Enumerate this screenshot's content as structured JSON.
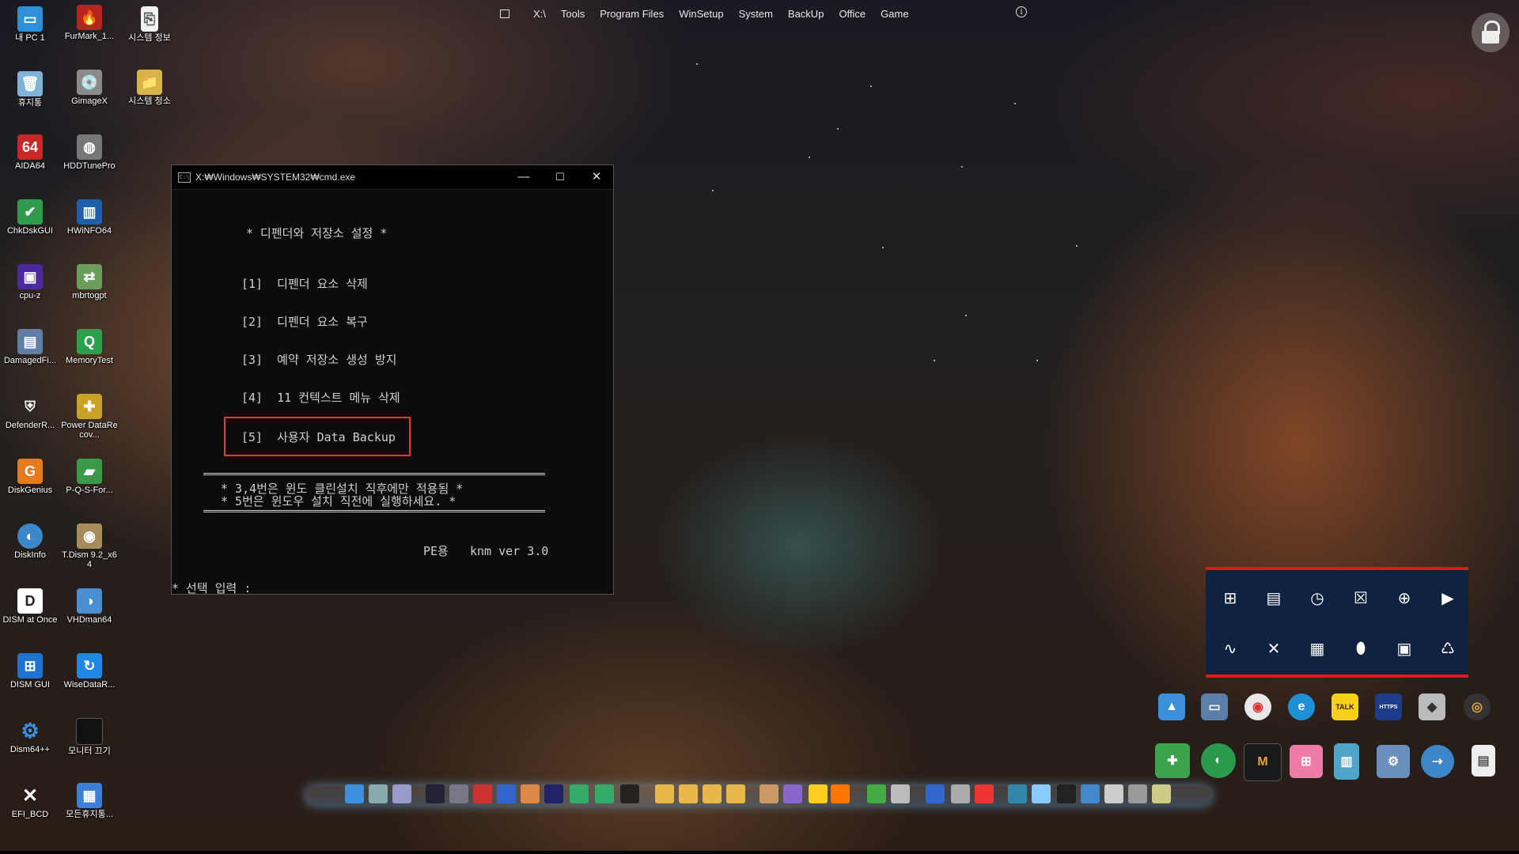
{
  "topmenu": {
    "items": [
      "X:\\",
      "Tools",
      "Program Files",
      "WinSetup",
      "System",
      "BackUp",
      "Office",
      "Game"
    ]
  },
  "desktop_icons": [
    {
      "label": "내 PC 1",
      "icon": "monitor-icon"
    },
    {
      "label": "FurMark_1...",
      "icon": "furmark-icon"
    },
    {
      "label": "시스템 정보",
      "icon": "document-icon"
    },
    {
      "label": "휴지통",
      "icon": "recycle-bin-icon"
    },
    {
      "label": "GimageX",
      "icon": "gimagex-icon"
    },
    {
      "label": "시스템 청소",
      "icon": "folder-icon"
    },
    {
      "label": "AIDA64",
      "icon": "aida64-icon"
    },
    {
      "label": "HDDTunePro",
      "icon": "disk-icon"
    },
    {
      "label": "ChkDskGUI",
      "icon": "chkdsk-icon"
    },
    {
      "label": "HWiNFO64",
      "icon": "hwinfo-icon"
    },
    {
      "label": "cpu-z",
      "icon": "cpuz-icon"
    },
    {
      "label": "mbrtogpt",
      "icon": "mbrtogpt-icon"
    },
    {
      "label": "DamagedFi...",
      "icon": "damaged-files-icon"
    },
    {
      "label": "MemoryTest",
      "icon": "memtest-icon"
    },
    {
      "label": "DefenderR...",
      "icon": "shield-icon"
    },
    {
      "label": "Power DataRecov...",
      "icon": "recovery-icon"
    },
    {
      "label": "DiskGenius",
      "icon": "diskgenius-icon"
    },
    {
      "label": "P-Q-S-For...",
      "icon": "pqs-icon"
    },
    {
      "label": "DiskInfo",
      "icon": "diskinfo-icon"
    },
    {
      "label": "T.Dism 9.2_x64",
      "icon": "tdism-icon"
    },
    {
      "label": "DISM at Once",
      "icon": "dism-once-icon"
    },
    {
      "label": "VHDman64",
      "icon": "vhdman-icon"
    },
    {
      "label": "DISM GUI",
      "icon": "windows-icon"
    },
    {
      "label": "WiseDataR...",
      "icon": "wise-icon"
    },
    {
      "label": "Dism64++",
      "icon": "gear-icon"
    },
    {
      "label": "모니터 끄기",
      "icon": "monitor-off-icon"
    },
    {
      "label": "EFI_BCD",
      "icon": "tools-icon"
    },
    {
      "label": "모든휴지통...",
      "icon": "all-recycle-icon"
    }
  ],
  "cmd": {
    "title": "X:₩Windows₩SYSTEM32₩cmd.exe",
    "heading": "* 디펜더와 저장소 설정 *",
    "options": [
      "[1]  디펜더 요소 삭제",
      "[2]  디펜더 요소 복구",
      "[3]  예약 저장소 생성 방지",
      "[4]  11 컨텍스트 메뉴 삭제",
      "[5]  사용자 Data Backup"
    ],
    "notes": [
      "* 3,4번은 윈도 클린설치 직후에만 적용됨 *",
      "* 5번은 윈도우 설치 직전에 실행하세요. *"
    ],
    "version": "PE용   knm ver 3.0",
    "prompt": "* 선택 입력 :"
  },
  "panel": {
    "row1": [
      "windows-icon",
      "notepad-icon",
      "clock-icon",
      "close-box-icon",
      "globe-icon",
      "terminal-icon"
    ],
    "row2": [
      "pulse-icon",
      "tools-icon",
      "calculator-icon",
      "mouse-icon",
      "screen-capture-icon",
      "recycle-icon"
    ]
  },
  "tray": {
    "row1": [
      "photo-icon",
      "screen-icon",
      "chrome-icon",
      "edge-icon",
      "kakaotalk-icon",
      "https-icon",
      "eraser-icon",
      "media-player-icon"
    ],
    "row2": [
      "puzzle-icon",
      "drive-icon",
      "memory-icon",
      "office-icon",
      "book-icon",
      "network-icon",
      "pipe-icon",
      "file-icon"
    ],
    "kakaotalk_label": "TALK",
    "https_label": "HTTPS",
    "memory_label": "M"
  },
  "colors": {
    "accent_red": "#e01818",
    "panel_bg": "#0f2340",
    "console_bg": "#0c0c0c"
  }
}
